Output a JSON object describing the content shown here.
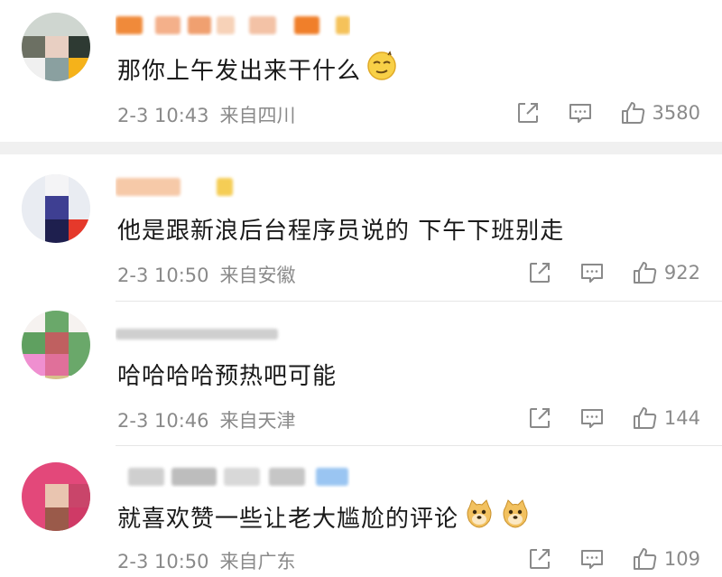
{
  "comments": [
    {
      "text": "那你上午发出来干什么",
      "date": "2-3 10:43",
      "location": "来自四川",
      "likes": "3580",
      "emoji": [
        "smirk-emoji"
      ]
    },
    {
      "text": "他是跟新浪后台程序员说的 下午下班别走",
      "date": "2-3 10:50",
      "location": "来自安徽",
      "likes": "922",
      "emoji": []
    },
    {
      "text": "哈哈哈哈预热吧可能",
      "date": "2-3 10:46",
      "location": "来自天津",
      "likes": "144",
      "emoji": []
    },
    {
      "text": "就喜欢赞一些让老大尴尬的评论",
      "date": "2-3 10:50",
      "location": "来自广东",
      "likes": "109",
      "emoji": [
        "doge-emoji",
        "doge-emoji"
      ]
    }
  ],
  "icons": {
    "share": "share-icon",
    "comment": "comment-icon",
    "like": "thumbs-up-icon"
  },
  "colors": {
    "meta_text": "#8a8a8a",
    "body_text": "#1a1a1a",
    "divider": "#f0f0f0"
  }
}
